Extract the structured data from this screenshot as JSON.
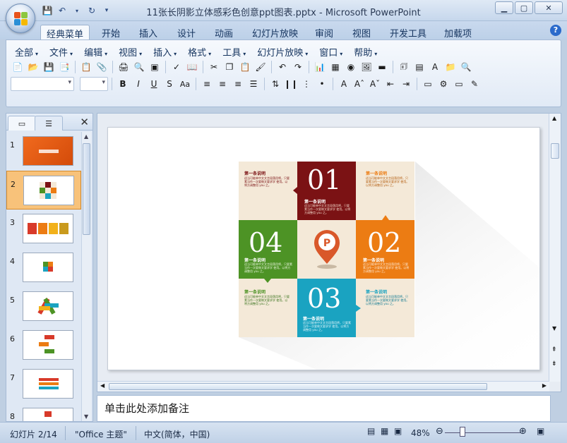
{
  "window": {
    "title": "11张长阴影立体感彩色创意ppt图表.pptx - Microsoft PowerPoint",
    "minimize_icon": "minimize-icon",
    "maximize_icon": "maximize-icon",
    "close_icon": "close-icon"
  },
  "ribbon": {
    "tabs": [
      "经典菜单",
      "开始",
      "插入",
      "设计",
      "动画",
      "幻灯片放映",
      "审阅",
      "视图",
      "开发工具",
      "加载项"
    ],
    "active_tab": 0,
    "menus": [
      "全部",
      "文件",
      "编辑",
      "视图",
      "插入",
      "格式",
      "工具",
      "幻灯片放映",
      "窗口",
      "帮助"
    ]
  },
  "slides_panel": {
    "numbers": [
      "1",
      "2",
      "3",
      "4",
      "5",
      "6",
      "7",
      "8"
    ],
    "selected": 2
  },
  "slide": {
    "cells": {
      "n01": "01",
      "n02": "02",
      "n03": "03",
      "n04": "04",
      "heading": "第一条说明",
      "body": "适当可能单中文文言段落用将，只要素当作一次要做文要求学 使用。以将方调整用 you 之。"
    }
  },
  "notes": {
    "placeholder": "单击此处添加备注"
  },
  "status": {
    "slide": "幻灯片 2/14",
    "theme": "\"Office 主题\"",
    "language": "中文(简体，中国)",
    "zoom": "48%"
  },
  "colors": {
    "dark_red": "#7b1214",
    "orange": "#ec7c13",
    "teal": "#1aa3c1",
    "green": "#4d9325",
    "cream": "#f4e9d8"
  }
}
